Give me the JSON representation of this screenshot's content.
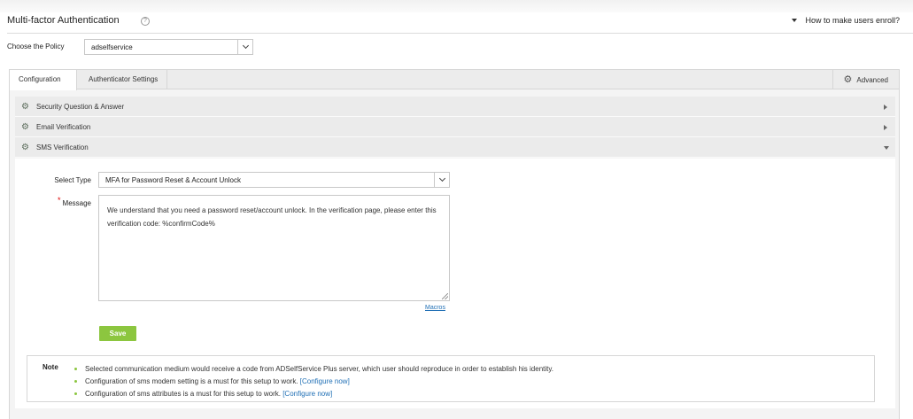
{
  "header": {
    "title": "Multi-factor Authentication",
    "help_icon": "?",
    "enroll_link": "How to make users enroll?"
  },
  "policy": {
    "label": "Choose the Policy",
    "value": "adselfservice"
  },
  "tabs": {
    "configuration": "Configuration",
    "authenticator_settings": "Authenticator Settings",
    "advanced": "Advanced",
    "gear_icon": "⚙"
  },
  "accordion": {
    "icon": "⚙",
    "items": [
      {
        "label": "Security Question & Answer",
        "state": "collapsed"
      },
      {
        "label": "Email Verification",
        "state": "collapsed"
      },
      {
        "label": "SMS Verification",
        "state": "expanded"
      }
    ]
  },
  "sms": {
    "select_type_label": "Select Type",
    "select_type_value": "MFA for Password Reset & Account Unlock",
    "message_label": "Message",
    "required_mark": "*",
    "message_value": "We understand that you need a password reset/account unlock. In the verification page, please enter this verification code: %confirmCode%",
    "macros_label": "Macros",
    "save_label": "Save"
  },
  "note": {
    "label": "Note",
    "items": [
      {
        "text": "Selected communication medium would receive a code from ADSelfService Plus server, which user should reproduce in order to establish his identity.",
        "link": ""
      },
      {
        "text": "Configuration of sms modem setting is a must for this setup to work. ",
        "link": "[Configure now]"
      },
      {
        "text": "Configuration of sms attributes is a must for this setup to work. ",
        "link": "[Configure now]"
      }
    ]
  },
  "colors": {
    "accent_green": "#8cc63f",
    "link_blue": "#1f6fb5",
    "required_red": "#dd0000"
  }
}
